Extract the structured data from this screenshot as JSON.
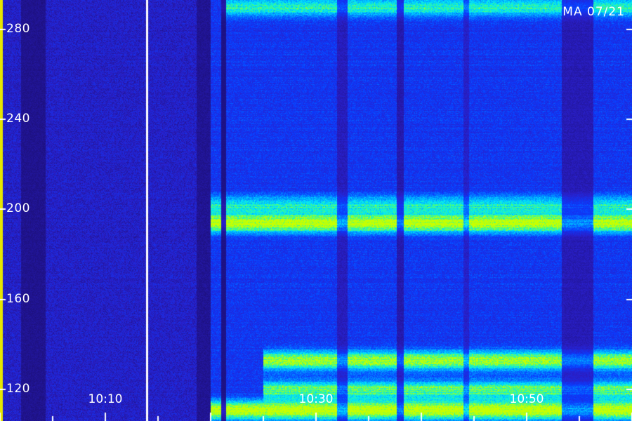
{
  "chart_data": {
    "type": "heatmap",
    "title": "",
    "xlabel": "",
    "ylabel": "",
    "station_label": "MA 07/21",
    "y_ticks": [
      {
        "value": 280,
        "label": "280"
      },
      {
        "value": 240,
        "label": "240"
      },
      {
        "value": 200,
        "label": "200"
      },
      {
        "value": 160,
        "label": "160"
      },
      {
        "value": 120,
        "label": "120"
      }
    ],
    "x_ticks": [
      {
        "value": "10:10",
        "label": "10:10"
      },
      {
        "value": "10:30",
        "label": "10:30"
      },
      {
        "value": "10:50",
        "label": "10:50"
      }
    ],
    "ylim": [
      106,
      293
    ],
    "xlim": [
      "10:00",
      "11:00"
    ],
    "colormap": [
      "#1a0d6e",
      "#2a1fc8",
      "#0a3cff",
      "#0096ff",
      "#00e6ff",
      "#40ff80",
      "#c8ff00"
    ],
    "axis_color": "#ffffff",
    "left_axis_bar_color": "#e6e600",
    "features": [
      {
        "name": "band",
        "y_value": 202,
        "time_start": "10:20",
        "time_end": "11:00",
        "intensity": 0.45
      },
      {
        "name": "band",
        "y_value": 194,
        "time_start": "10:20",
        "time_end": "11:00",
        "intensity": 0.85
      },
      {
        "name": "band",
        "y_value": 133,
        "time_start": "10:25",
        "time_end": "11:00",
        "intensity": 0.75
      },
      {
        "name": "band",
        "y_value": 120,
        "time_start": "10:25",
        "time_end": "11:00",
        "intensity": 0.6
      },
      {
        "name": "band",
        "y_value": 290,
        "time_start": "10:21",
        "time_end": "11:00",
        "intensity": 0.5
      },
      {
        "name": "band",
        "y_value": 111,
        "time_start": "10:20",
        "time_end": "11:00",
        "intensity": 0.9
      }
    ]
  }
}
